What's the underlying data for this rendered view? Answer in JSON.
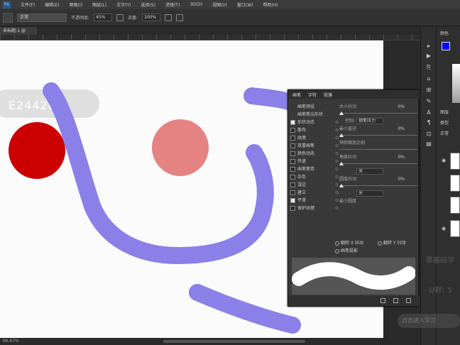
{
  "menubar": {
    "items": [
      "文件(F)",
      "编辑(E)",
      "图像(I)",
      "图层(L)",
      "文字(Y)",
      "选择(S)",
      "滤镜(T)",
      "3D(D)",
      "视图(V)",
      "窗口(W)",
      "帮助(H)"
    ]
  },
  "options": {
    "mode_value": "正常",
    "opacity_label": "不透明度:",
    "opacity_value": "45%",
    "flow_label": "流量:",
    "flow_value": "100%"
  },
  "document": {
    "tab_label": "未标题-1 @ 66.7%(图层 1, RGB/8) *",
    "status": "66.67%"
  },
  "canvas": {
    "hex_readout": "E24420"
  },
  "colors": {
    "foreground": "#0000ff",
    "background": "#ffffff",
    "stroke": "#8a80e8",
    "red_circle": "#cc0000",
    "pink_circle": "#e58383"
  },
  "brush_panel": {
    "tabs": [
      "画笔",
      "字符",
      "段落"
    ],
    "top_button": "画笔预设",
    "items": [
      {
        "label": "画笔笔尖形状",
        "checked": false
      },
      {
        "label": "形状动态",
        "checked": true
      },
      {
        "label": "散布",
        "checked": false
      },
      {
        "label": "纹理",
        "checked": false
      },
      {
        "label": "双重画笔",
        "checked": false
      },
      {
        "label": "颜色动态",
        "checked": false
      },
      {
        "label": "传递",
        "checked": false
      },
      {
        "label": "画笔笔势",
        "checked": false
      },
      {
        "label": "杂色",
        "checked": false
      },
      {
        "label": "湿边",
        "checked": false
      },
      {
        "label": "建立",
        "checked": false
      },
      {
        "label": "平滑",
        "checked": true
      },
      {
        "label": "保护纹理",
        "checked": false
      }
    ],
    "size_jitter_label": "大小抖动",
    "size_jitter_value": "0%",
    "control_label": "控制:",
    "control_value": "钢笔压力",
    "min_diameter_label": "最小直径",
    "min_diameter_value": "0%",
    "tilt_scale_label": "倾斜缩放比例",
    "angle_jitter_label": "角度抖动",
    "angle_jitter_value": "0%",
    "control2_value": "关",
    "roundness_jitter_label": "圆度抖动",
    "roundness_jitter_value": "0%",
    "control3_value": "关",
    "min_roundness_label": "最小圆度",
    "flip_x_label": "翻转 X 抖动",
    "flip_y_label": "翻转 Y 抖动",
    "projection_label": "画笔投影"
  },
  "right_panel": {
    "header1": "颜色",
    "header2": "图层",
    "kind_label": "类型",
    "mode_label": "正常"
  },
  "watermark": {
    "line1": "零基础学",
    "line2": "Q群: 5",
    "line3": "点击进入学习"
  }
}
